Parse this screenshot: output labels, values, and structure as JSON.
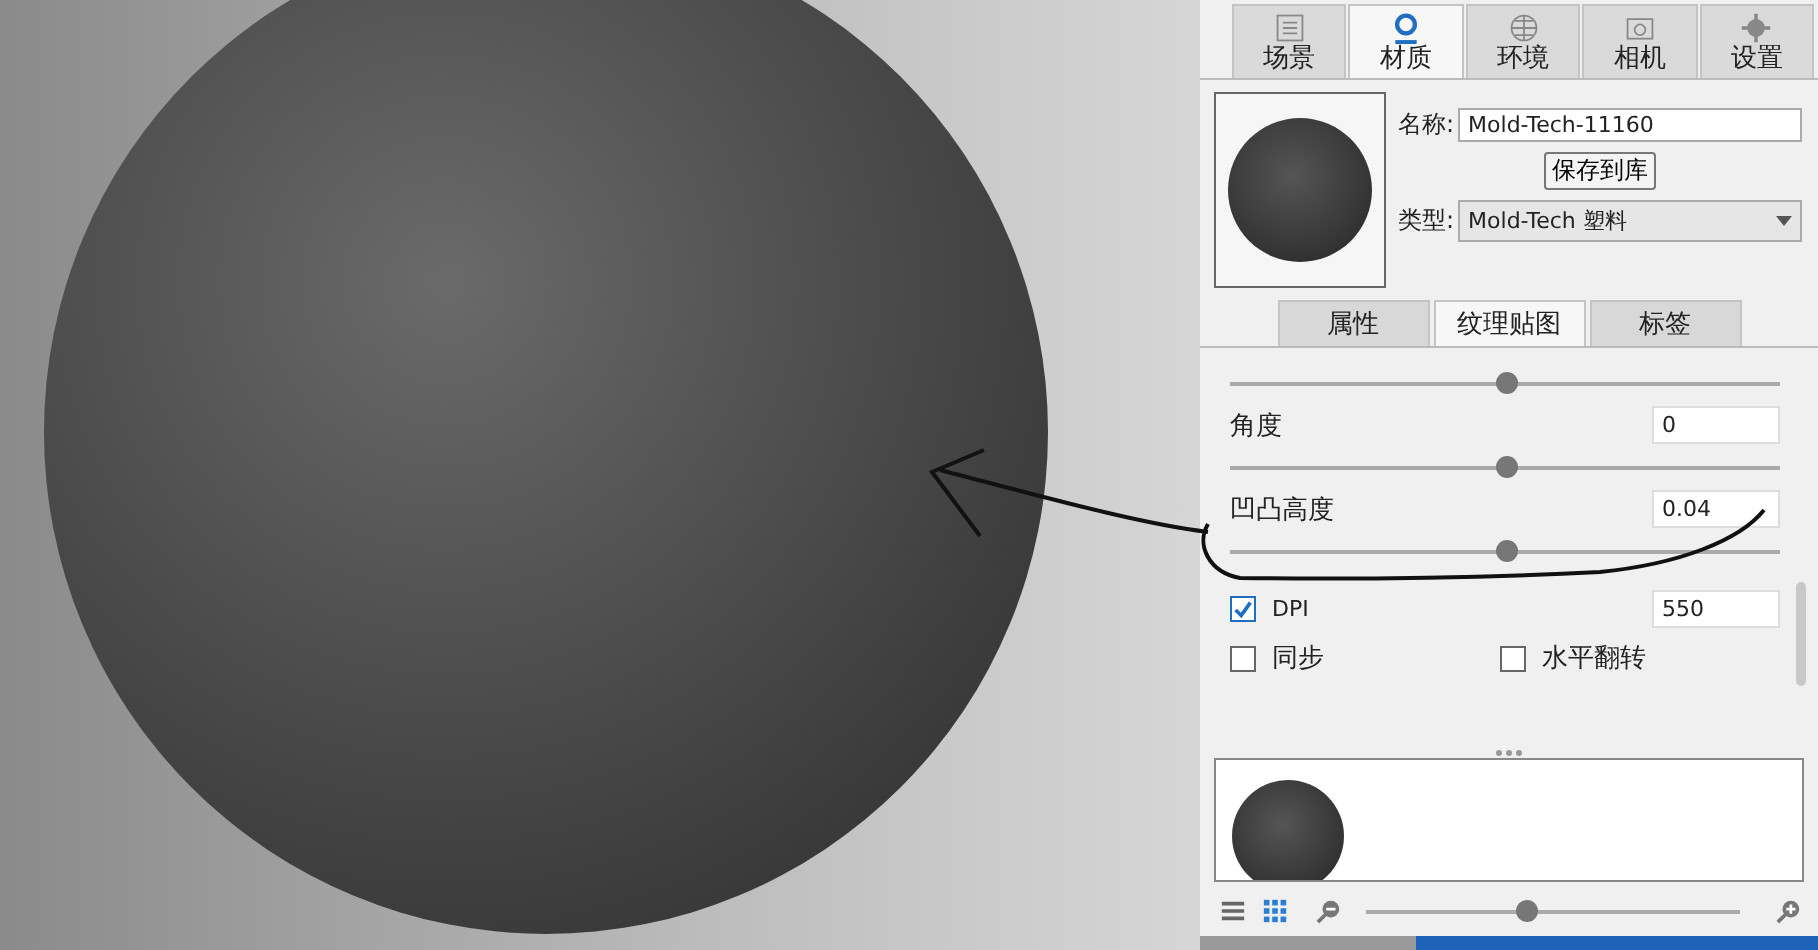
{
  "tabs": [
    {
      "label": "场景",
      "selected": false
    },
    {
      "label": "材质",
      "selected": true
    },
    {
      "label": "环境",
      "selected": false
    },
    {
      "label": "相机",
      "selected": false
    },
    {
      "label": "设置",
      "selected": false
    }
  ],
  "material": {
    "name_label": "名称:",
    "name_value": "Mold-Tech-11160",
    "save_button": "保存到库",
    "type_label": "类型:",
    "type_value": "Mold-Tech 塑料"
  },
  "subtabs": [
    {
      "label": "属性",
      "selected": false
    },
    {
      "label": "纹理贴图",
      "selected": true
    },
    {
      "label": "标签",
      "selected": false
    }
  ],
  "sliders": [
    {
      "level": 0.5
    },
    {
      "label": "角度",
      "value": "0",
      "level": 0.5
    },
    {
      "label": "凹凸高度",
      "value": "0.04",
      "level": 0.5
    }
  ],
  "dpi": {
    "label": "DPI",
    "checked": true,
    "value": "550"
  },
  "checkboxes": [
    {
      "label": "同步",
      "checked": false
    },
    {
      "label": "水平翻转",
      "checked": false
    }
  ],
  "toolbar": {
    "views": [
      {
        "kind": "list",
        "selected": false
      },
      {
        "kind": "grid",
        "selected": true
      }
    ],
    "zoom": {
      "level": 0.43
    }
  }
}
